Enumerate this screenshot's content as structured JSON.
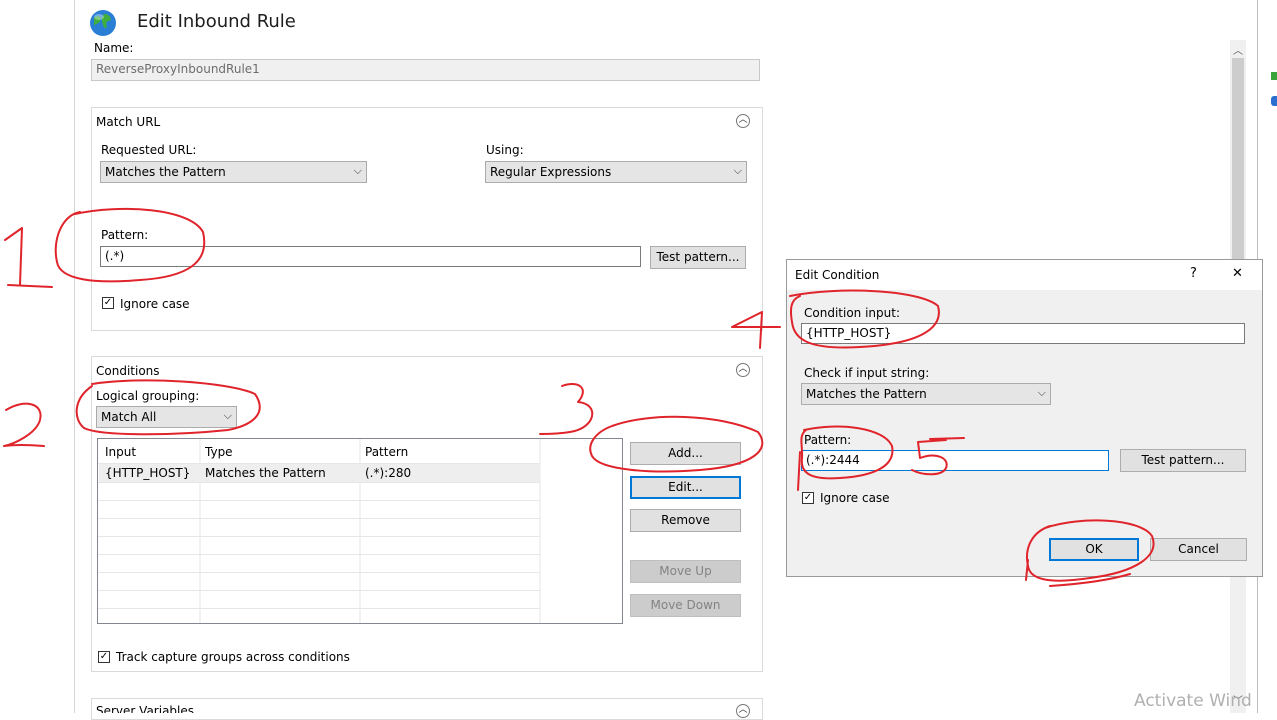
{
  "title": "Edit Inbound Rule",
  "name_label": "Name:",
  "name_value": "ReverseProxyInboundRule1",
  "match_url": {
    "title": "Match URL",
    "requested_url_label": "Requested URL:",
    "requested_url_value": "Matches the Pattern",
    "using_label": "Using:",
    "using_value": "Regular Expressions",
    "pattern_label": "Pattern:",
    "pattern_value": "(.*)",
    "test_pattern_button": "Test pattern...",
    "ignore_case_label": "Ignore case",
    "ignore_case_checked": true
  },
  "conditions": {
    "title": "Conditions",
    "logical_grouping_label": "Logical grouping:",
    "logical_grouping_value": "Match All",
    "columns": [
      "Input",
      "Type",
      "Pattern"
    ],
    "rows": [
      {
        "input": "{HTTP_HOST}",
        "type": "Matches the Pattern",
        "pattern": "(.*):280"
      }
    ],
    "buttons": {
      "add": "Add...",
      "edit": "Edit...",
      "remove": "Remove",
      "move_up": "Move Up",
      "move_down": "Move Down"
    },
    "track_capture_label": "Track capture groups across conditions",
    "track_capture_checked": true
  },
  "next_section_title": "Server Variables",
  "dialog": {
    "title": "Edit Condition",
    "help_glyph": "?",
    "close_glyph": "✕",
    "condition_input_label": "Condition input:",
    "condition_input_value": "{HTTP_HOST}",
    "check_label": "Check if input string:",
    "check_value": "Matches the Pattern",
    "pattern_label": "Pattern:",
    "pattern_value": "(.*):2444",
    "test_pattern_button": "Test pattern...",
    "ignore_case_label": "Ignore case",
    "ignore_case_checked": true,
    "ok_button": "OK",
    "cancel_button": "Cancel"
  },
  "watermark": "Activate Wind",
  "icons": {
    "globe": "globe-icon",
    "collapse": "chevron-up-circle-icon",
    "dropdown": "chevron-down-icon",
    "check": "checkmark-icon"
  },
  "colors": {
    "annotation": "#e0242b",
    "focus_border": "#0078d7",
    "dialog_bg": "#f0f0f0"
  },
  "annotations": [
    "1",
    "2",
    "3",
    "4",
    "5"
  ]
}
